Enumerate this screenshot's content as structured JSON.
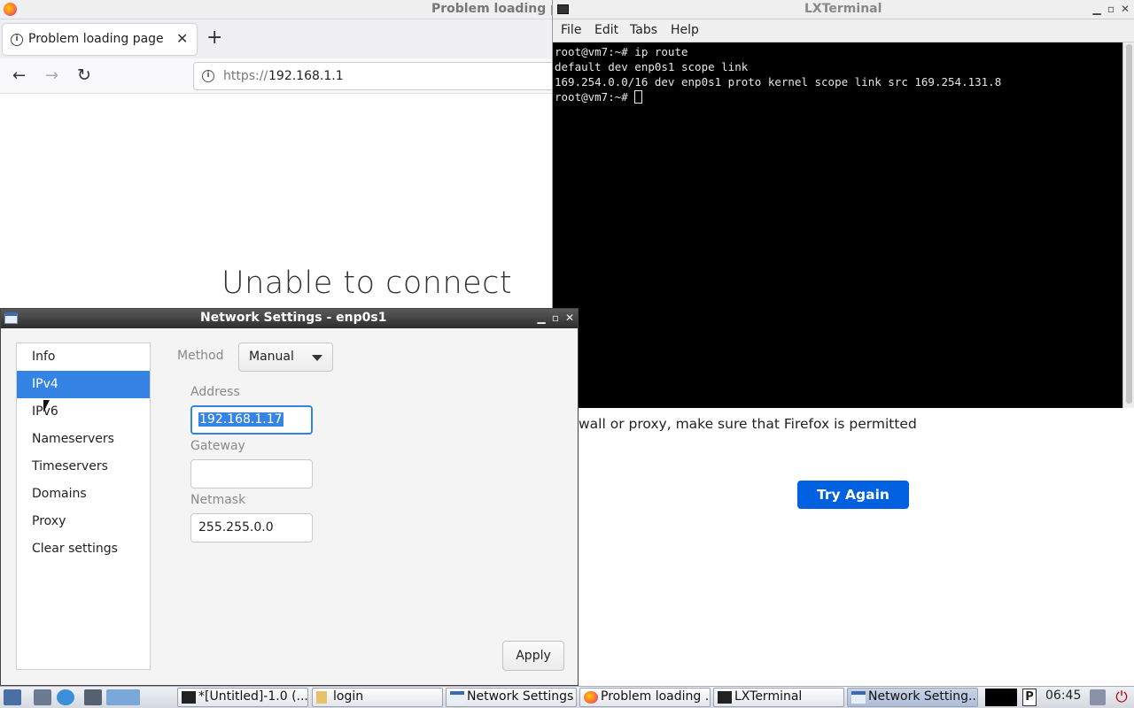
{
  "firefox": {
    "window_title": "Problem loading page",
    "tab_label": "Problem loading page",
    "url_scheme": "https://",
    "url_host": "192.168.1.1",
    "error_title": "Unable to connect",
    "error_text_fragment": "wall or proxy, make sure that Firefox is permitted",
    "try_again_label": "Try Again"
  },
  "terminal": {
    "title": "LXTerminal",
    "menu": [
      "File",
      "Edit",
      "Tabs",
      "Help"
    ],
    "lines": [
      "root@vm7:~# ip route",
      "default dev enp0s1 scope link",
      "169.254.0.0/16 dev enp0s1 proto kernel scope link src 169.254.131.8",
      "root@vm7:~# "
    ]
  },
  "network_settings": {
    "title": "Network Settings - enp0s1",
    "sidebar": [
      "Info",
      "IPv4",
      "IPv6",
      "Nameservers",
      "Timeservers",
      "Domains",
      "Proxy",
      "Clear settings"
    ],
    "selected": "IPv4",
    "method_label": "Method",
    "method_value": "Manual",
    "address_label": "Address",
    "address_value": "192.168.1.17",
    "gateway_label": "Gateway",
    "gateway_value": "",
    "netmask_label": "Netmask",
    "netmask_value": "255.255.0.0",
    "apply_label": "Apply"
  },
  "taskbar": {
    "windows": [
      "*[Untitled]-1.0 (...",
      "login",
      "Network Settings",
      "Problem loading ...",
      "LXTerminal",
      "Network Setting..."
    ],
    "clock": "06:45"
  },
  "colors": {
    "selection": "#3584e4",
    "try_again": "#0061e0",
    "terminal_bg": "#000000"
  }
}
